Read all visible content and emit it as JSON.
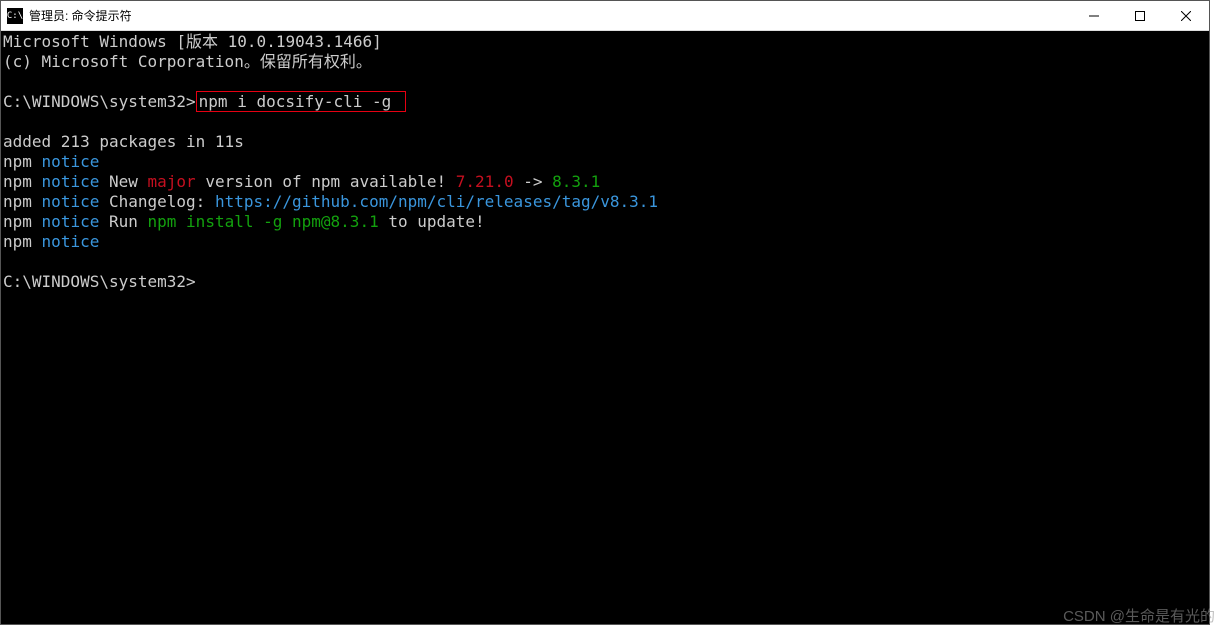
{
  "window": {
    "title": "管理员: 命令提示符"
  },
  "terminal": {
    "banner_line1": "Microsoft Windows [版本 10.0.19043.1466]",
    "banner_line2": "(c) Microsoft Corporation。保留所有权利。",
    "prompt1": "C:\\WINDOWS\\system32>",
    "command1": "npm i docsify-cli -g",
    "output_added": "added 213 packages in 11s",
    "npm_prefix": "npm",
    "notice_label": "notice",
    "notice1_text_a": " New ",
    "notice1_major": "major",
    "notice1_text_b": " version of npm available! ",
    "notice1_oldver": "7.21.0",
    "notice1_arrow": " -> ",
    "notice1_newver": "8.3.1",
    "notice2_text": " Changelog: ",
    "notice2_url": "https://github.com/npm/cli/releases/tag/v8.3.1",
    "notice3_text_a": " Run ",
    "notice3_cmd": "npm install -g npm@8.3.1",
    "notice3_text_b": " to update!",
    "prompt2": "C:\\WINDOWS\\system32>"
  },
  "watermark": "CSDN @生命是有光的"
}
